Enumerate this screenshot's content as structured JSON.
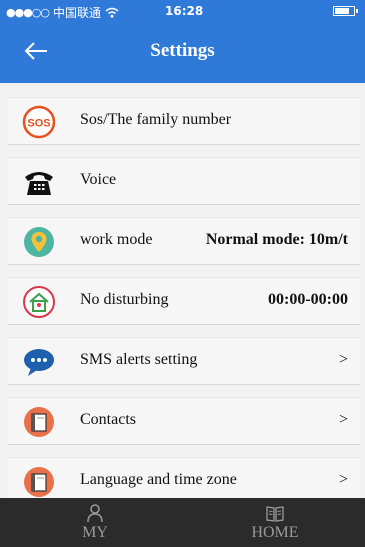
{
  "status_bar": {
    "carrier": "中国联通",
    "time": "16:28",
    "battery_level": 0.8
  },
  "header": {
    "title": "Settings"
  },
  "settings": [
    {
      "icon": "sos-icon",
      "label": "Sos/The family number",
      "value": "",
      "chevron": ""
    },
    {
      "icon": "telephone-icon",
      "label": "Voice",
      "value": "",
      "chevron": ""
    },
    {
      "icon": "location-pin-icon",
      "label": "work mode",
      "value": "Normal mode: 10m/t",
      "chevron": ""
    },
    {
      "icon": "no-disturb-icon",
      "label": "No disturbing",
      "value": "00:00-00:00",
      "chevron": ""
    },
    {
      "icon": "chat-bubble-icon",
      "label": "SMS alerts setting",
      "value": "",
      "chevron": ">"
    },
    {
      "icon": "contacts-book-icon",
      "label": "Contacts",
      "value": "",
      "chevron": ">"
    },
    {
      "icon": "language-book-icon",
      "label": "Language and time zone",
      "value": "",
      "chevron": ">"
    }
  ],
  "tabs": [
    {
      "icon": "person-icon",
      "label": "MY"
    },
    {
      "icon": "book-icon",
      "label": "HOME"
    }
  ],
  "colors": {
    "header_blue": "#2f7ad8",
    "tabbar_dark": "#2b2b2b",
    "sos_orange": "#e8501e",
    "chat_blue": "#1f5fb0",
    "book_orange": "#e9714a"
  }
}
